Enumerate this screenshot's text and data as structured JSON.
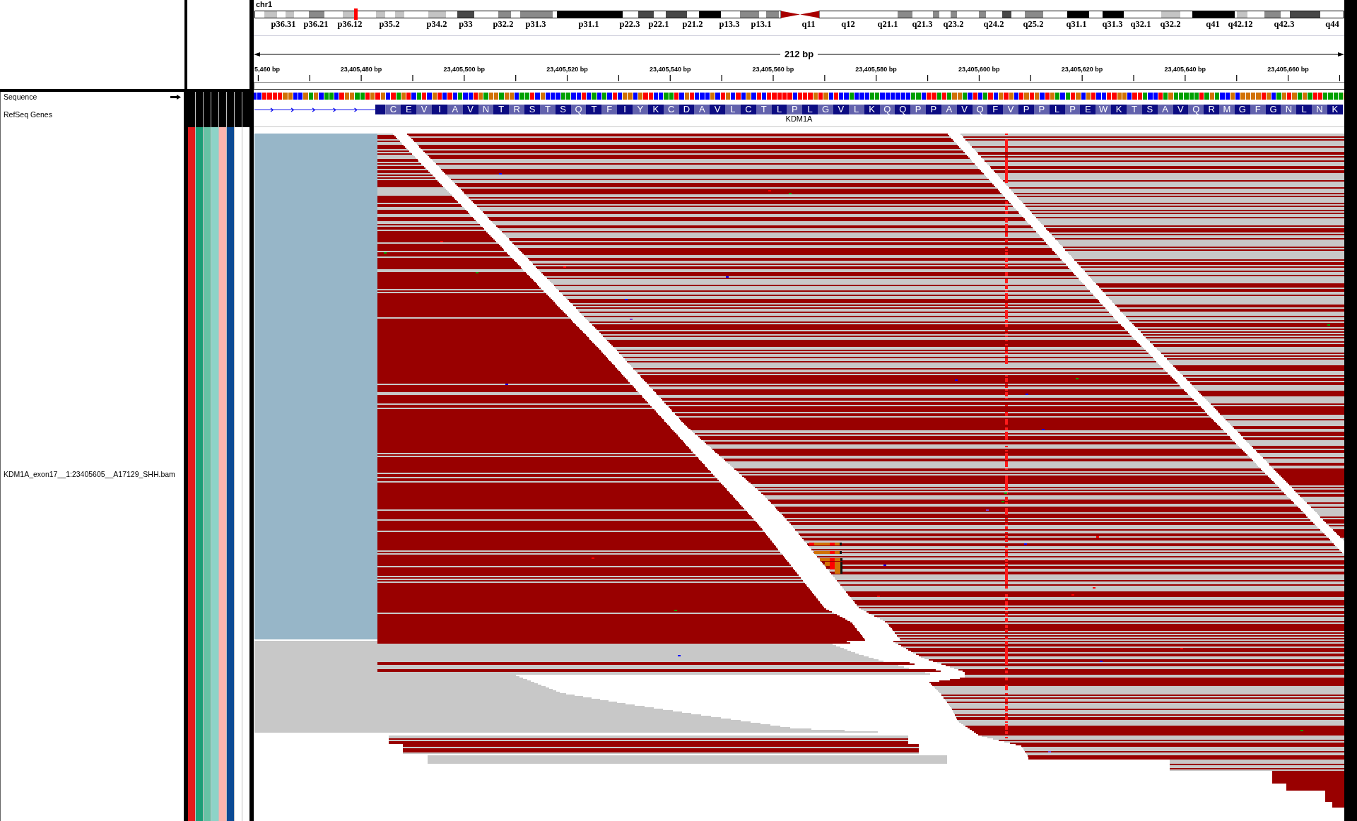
{
  "header": {
    "chromosome": "chr1",
    "band_labels": [
      "p36.31",
      "p36.21",
      "p36.12",
      "p35.2",
      "p34.2",
      "p33",
      "p32.2",
      "p31.3",
      "p31.1",
      "p22.3",
      "p22.1",
      "p21.2",
      "p13.3",
      "p13.1",
      "q11",
      "q12",
      "q21.1",
      "q21.3",
      "q23.2",
      "q24.2",
      "q25.2",
      "q31.1",
      "q31.3",
      "q32.1",
      "q32.2",
      "q41",
      "q42.12",
      "q42.3",
      "q44"
    ]
  },
  "ruler": {
    "span": "212 bp",
    "ticks": [
      "5,460 bp",
      "23,405,480 bp",
      "23,405,500 bp",
      "23,405,520 bp",
      "23,405,540 bp",
      "23,405,560 bp",
      "23,405,580 bp",
      "23,405,600 bp",
      "23,405,620 bp",
      "23,405,640 bp",
      "23,405,660 bp"
    ]
  },
  "tracks": [
    {
      "kind": "sequence",
      "name": "Sequence",
      "forward_strand": true
    },
    {
      "kind": "gene",
      "name": "RefSeq Genes",
      "gene": "KDM1A",
      "amino_acids": [
        "C",
        "E",
        "V",
        "I",
        "A",
        "V",
        "N",
        "T",
        "R",
        "S",
        "T",
        "S",
        "Q",
        "T",
        "F",
        "I",
        "Y",
        "K",
        "C",
        "D",
        "A",
        "V",
        "L",
        "C",
        "T",
        "L",
        "P",
        "L",
        "G",
        "V",
        "L",
        "K",
        "Q",
        "Q",
        "P",
        "P",
        "A",
        "V",
        "Q",
        "F",
        "V",
        "P",
        "P",
        "L",
        "P",
        "E",
        "W",
        "K",
        "T",
        "S",
        "A",
        "V",
        "Q",
        "R",
        "M",
        "G",
        "F",
        "G",
        "N",
        "L",
        "N",
        "K"
      ]
    },
    {
      "kind": "alignment",
      "name": "KDM1A_exon17__1:23405605__A17129_SHH.bam",
      "attributes": [
        {
          "color": "#e41a1c"
        },
        {
          "color": "#1b9e77"
        },
        {
          "color": "#66c2a5"
        },
        {
          "color": "#8dd3c7"
        },
        {
          "color": "#fbb4ae"
        },
        {
          "color": "#0b4a94"
        },
        {
          "color": "#ffffff"
        },
        {
          "color": "#ffffff"
        }
      ]
    }
  ]
}
